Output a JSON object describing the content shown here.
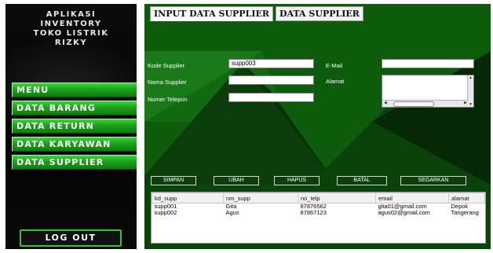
{
  "sidebar": {
    "app_title": [
      "APLIKASI",
      "INVENTORY",
      "TOKO LISTRIK",
      "RIZKY"
    ],
    "menu_label": "MENU",
    "items": [
      {
        "label": "DATA BARANG"
      },
      {
        "label": "DATA RETURN"
      },
      {
        "label": "DATA KARYAWAN"
      },
      {
        "label": "DATA SUPPLIER"
      }
    ],
    "logout_label": "LOG OUT"
  },
  "tabs": [
    {
      "label": "INPUT DATA SUPPLIER",
      "active": true
    },
    {
      "label": "DATA SUPPLIER",
      "active": false
    }
  ],
  "form": {
    "kode_label": "Kode Supplier",
    "kode_value": "supp003",
    "nama_label": "Nama Supplier",
    "nama_value": "",
    "telp_label": "Nomer Telepon",
    "telp_value": "",
    "email_label": "E-Mail",
    "email_value": "",
    "alamat_label": "Alamat",
    "alamat_value": ""
  },
  "buttons": {
    "simpan": "SIMPAN",
    "ubah": "UBAH",
    "hapus": "HAPUS",
    "batal": "BATAL",
    "segarkan": "SEGARKAN"
  },
  "table": {
    "columns": [
      "kd_supp",
      "nm_supp",
      "no_telp",
      "email",
      "alamat"
    ],
    "rows": [
      [
        "supp001",
        "Gita",
        "87876562",
        "gita01@gmail.com",
        "Depok"
      ],
      [
        "supp002",
        "Agus",
        "87867123",
        "agus02@gmail.com",
        "Tangerang"
      ]
    ]
  },
  "colors": {
    "sidebar_bg": "#050505",
    "menu_green": "#1ca11c",
    "main_bg": "#0c5c0c"
  }
}
